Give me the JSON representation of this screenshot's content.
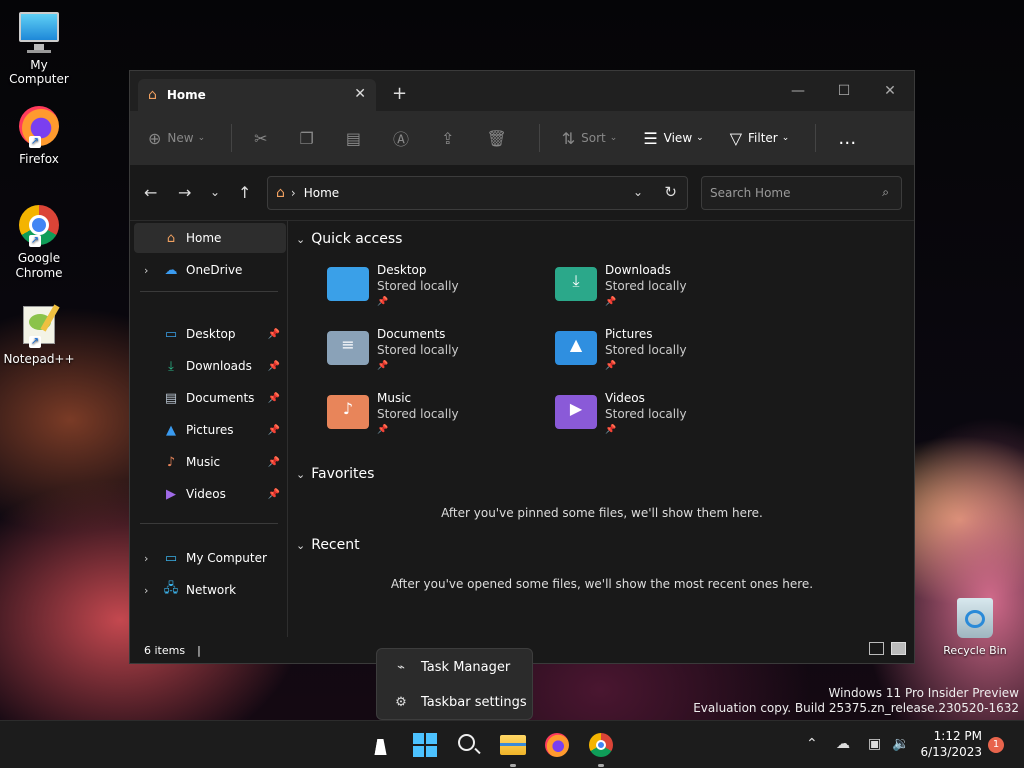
{
  "desktop": {
    "icons": [
      {
        "label": "My Computer",
        "icon": "monitor-icon"
      },
      {
        "label": "Firefox",
        "icon": "firefox-icon"
      },
      {
        "label": "Google Chrome",
        "icon": "chrome-icon"
      },
      {
        "label": "Notepad++",
        "icon": "notepadpp-icon"
      }
    ],
    "recycle_bin": "Recycle Bin",
    "watermark": {
      "line1": "Windows 11 Pro Insider Preview",
      "line2": "Evaluation copy. Build 25375.zn_release.230520-1632"
    }
  },
  "explorer": {
    "tab_title": "Home",
    "toolbar": {
      "new": "New",
      "sort": "Sort",
      "view": "View",
      "filter": "Filter",
      "more": "…"
    },
    "address": {
      "crumb": "Home"
    },
    "search": {
      "placeholder": "Search Home"
    },
    "sidebar": {
      "home": "Home",
      "onedrive": "OneDrive",
      "pinned": [
        {
          "label": "Desktop"
        },
        {
          "label": "Downloads"
        },
        {
          "label": "Documents"
        },
        {
          "label": "Pictures"
        },
        {
          "label": "Music"
        },
        {
          "label": "Videos"
        }
      ],
      "my_computer": "My Computer",
      "network": "Network"
    },
    "content": {
      "quick_access_title": "Quick access",
      "quick_access": [
        {
          "name": "Desktop",
          "sub": "Stored locally",
          "color": "#3aa0e8"
        },
        {
          "name": "Downloads",
          "sub": "Stored locally",
          "color": "#2ba88a"
        },
        {
          "name": "Documents",
          "sub": "Stored locally",
          "color": "#8aa2b8"
        },
        {
          "name": "Pictures",
          "sub": "Stored locally",
          "color": "#2f8fe0"
        },
        {
          "name": "Music",
          "sub": "Stored locally",
          "color": "#e8855a"
        },
        {
          "name": "Videos",
          "sub": "Stored locally",
          "color": "#8a5ad8"
        }
      ],
      "favorites_title": "Favorites",
      "favorites_empty": "After you've pinned some files, we'll show them here.",
      "recent_title": "Recent",
      "recent_empty": "After you've opened some files, we'll show the most recent ones here."
    },
    "status": {
      "items": "6 items"
    }
  },
  "context_menu": {
    "task_manager": "Task Manager",
    "taskbar_settings": "Taskbar settings"
  },
  "taskbar": {
    "time": "1:12 PM",
    "date": "6/13/2023",
    "notifications": "1"
  }
}
